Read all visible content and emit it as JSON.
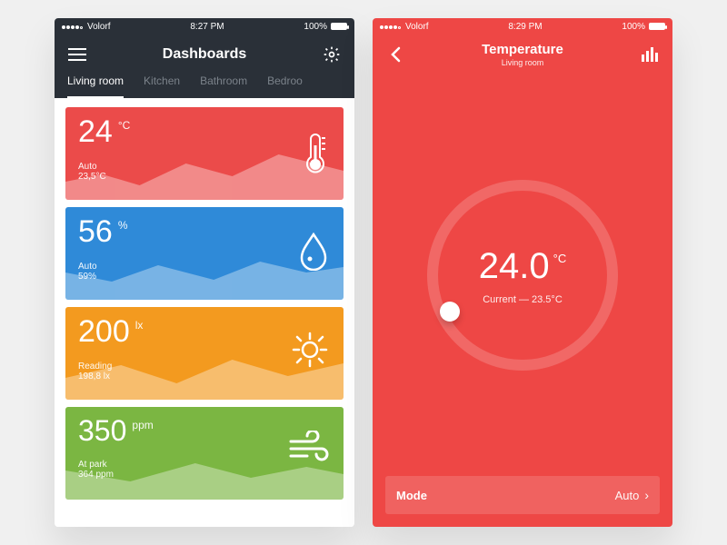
{
  "screen1": {
    "status": {
      "carrier": "Volorf",
      "time": "8:27 PM",
      "battery": "100%"
    },
    "header": {
      "title": "Dashboards"
    },
    "tabs": [
      "Living room",
      "Kitchen",
      "Bathroom",
      "Bedroo"
    ],
    "activeTab": 0,
    "cards": [
      {
        "value": "24",
        "unit": "°C",
        "mode": "Auto",
        "sub": "23,5°C"
      },
      {
        "value": "56",
        "unit": "%",
        "mode": "Auto",
        "sub": "59%"
      },
      {
        "value": "200",
        "unit": "lx",
        "mode": "Reading",
        "sub": "198,8 lx"
      },
      {
        "value": "350",
        "unit": "ppm",
        "mode": "At park",
        "sub": "364 ppm"
      }
    ]
  },
  "screen2": {
    "status": {
      "carrier": "Volorf",
      "time": "8:29 PM",
      "battery": "100%"
    },
    "header": {
      "title": "Temperature",
      "subtitle": "Living room"
    },
    "dial": {
      "value": "24.0",
      "unit": "°C",
      "current_label": "Current — 23.5°C"
    },
    "mode": {
      "label": "Mode",
      "value": "Auto"
    }
  }
}
